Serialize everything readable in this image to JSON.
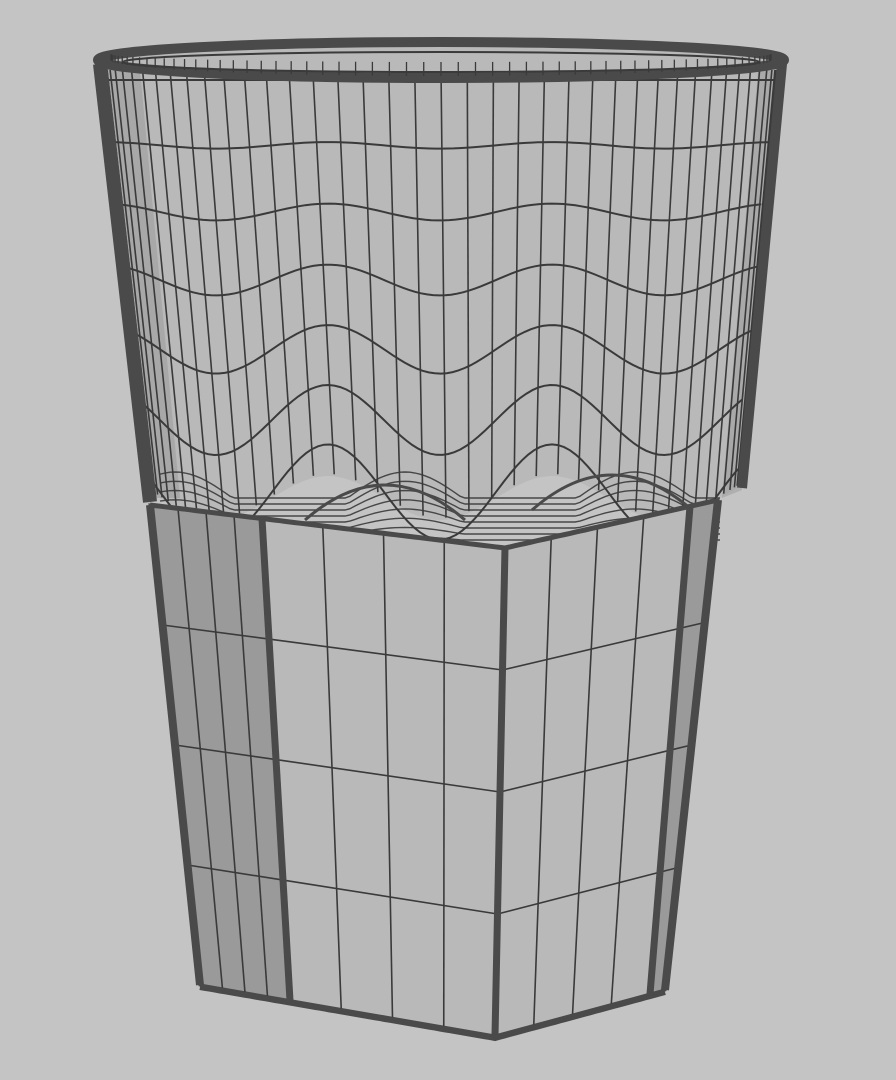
{
  "viewport": {
    "background_color": "#c4c4c4",
    "label": "",
    "object": {
      "semantic": "tumbler-glass-wireframe",
      "shading_mode": "wireframe-on-shaded",
      "surface_color": "#b9b9b9",
      "surface_dark_color": "#9a9a9a",
      "wire_color": "#3a3a3a",
      "edge_color": "#4a4a4a"
    }
  }
}
